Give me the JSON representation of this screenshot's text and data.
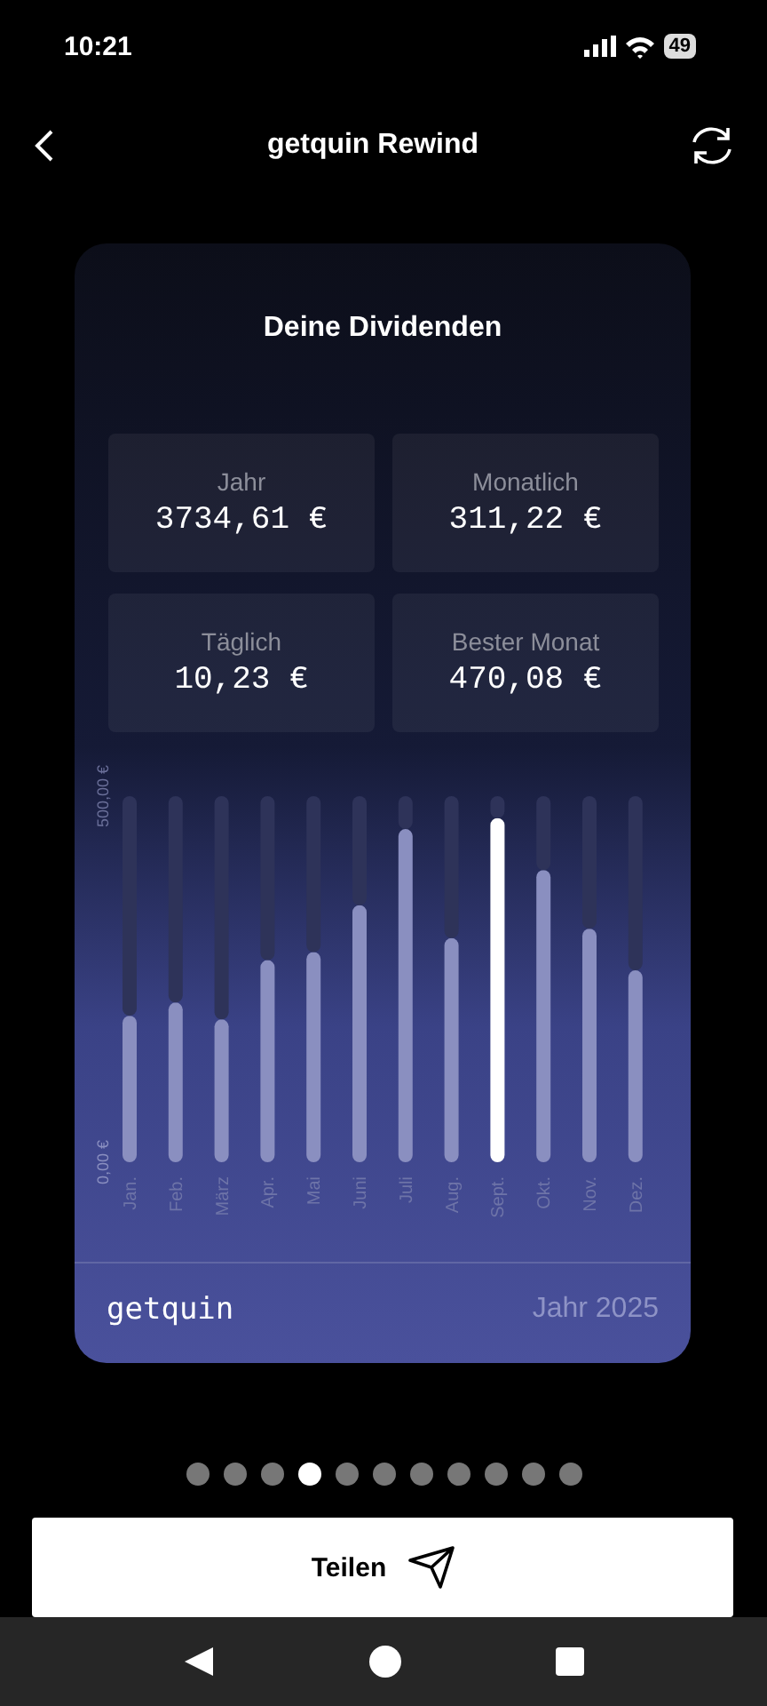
{
  "status_bar": {
    "time": "10:21",
    "battery": "49"
  },
  "header": {
    "title": "getquin Rewind"
  },
  "card": {
    "title": "Deine Dividenden",
    "stats": [
      {
        "label": "Jahr",
        "value": "3734,61 €"
      },
      {
        "label": "Monatlich",
        "value": "311,22 €"
      },
      {
        "label": "Täglich",
        "value": "10,23 €"
      },
      {
        "label": "Bester Monat",
        "value": "470,08 €"
      }
    ],
    "chart_data": {
      "type": "bar",
      "orientation": "vertical",
      "categories": [
        "Jan.",
        "Feb.",
        "März",
        "Apr.",
        "Mai",
        "Juni",
        "Juli",
        "Aug.",
        "Sept.",
        "Okt.",
        "Nov.",
        "Dez."
      ],
      "series": [
        {
          "color": "#8a8fc0",
          "values": [
            200,
            218,
            195,
            276,
            287,
            351,
            455,
            306,
            null,
            399,
            319,
            262
          ]
        },
        {
          "color": "#ffffff",
          "values": [
            null,
            null,
            null,
            null,
            null,
            null,
            null,
            null,
            470,
            null,
            null,
            null
          ]
        },
        {
          "color": "#2e3359",
          "values": [
            300,
            282,
            305,
            224,
            213,
            149,
            45,
            194,
            30,
            101,
            181,
            238
          ]
        }
      ],
      "stacked": true,
      "ylim": [
        0,
        500
      ],
      "yticks": [
        {
          "value": 0,
          "label": "0,00 €"
        },
        {
          "value": 500,
          "label": "500,00 €"
        }
      ]
    },
    "brand": "getquin",
    "period": "Jahr 2025"
  },
  "pager": [
    {
      "selected": false
    },
    {
      "selected": false
    },
    {
      "selected": false
    },
    {
      "selected": true
    },
    {
      "selected": false
    },
    {
      "selected": false
    },
    {
      "selected": false
    },
    {
      "selected": false
    },
    {
      "selected": false
    },
    {
      "selected": false
    },
    {
      "selected": false
    }
  ],
  "share_button": {
    "label": "Teilen"
  }
}
